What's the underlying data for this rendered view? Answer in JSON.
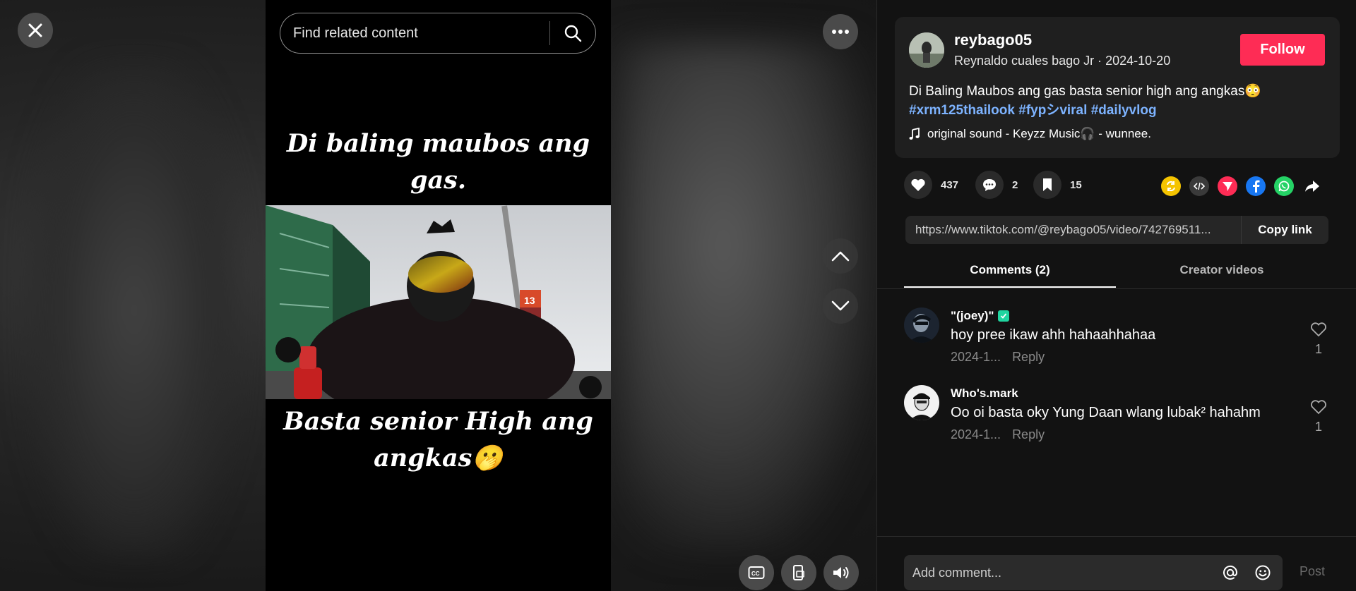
{
  "search": {
    "placeholder": "Find related content"
  },
  "video": {
    "caption_top": "Di baling maubos ang gas.",
    "caption_bottom": "Basta senior High ang angkas🫢",
    "sign_number": "13"
  },
  "author": {
    "username": "reybago05",
    "display_name": "Reynaldo cuales bago Jr",
    "separator": " · ",
    "date": "2024-10-20",
    "follow_label": "Follow"
  },
  "description": {
    "text": "Di Baling Maubos ang gas basta senior high ang angkas😳",
    "hashtags": [
      "#xrm125thailook",
      "#fypシviral",
      "#dailyvlog"
    ],
    "sound": "original sound - Keyzz Music🎧 - wunnee."
  },
  "actions": {
    "likes": "437",
    "comments": "2",
    "saves": "15"
  },
  "share": {
    "link": "https://www.tiktok.com/@reybago05/video/742769511...",
    "copy_label": "Copy link",
    "colors": {
      "repost": "#f5c400",
      "embed": "#3a3a3a",
      "send": "#fe2c55",
      "facebook": "#1877f2",
      "whatsapp": "#25d366"
    }
  },
  "tabs": [
    {
      "label": "Comments (2)",
      "active": true
    },
    {
      "label": "Creator videos",
      "active": false
    }
  ],
  "comments": [
    {
      "user": "\"(joey)\"",
      "verified": true,
      "text": "hoy pree ikaw ahh hahaahhahaa",
      "date": "2024-1...",
      "reply": "Reply",
      "likes": "1"
    },
    {
      "user": "Who's.mark",
      "verified": false,
      "text": "Oo oi basta oky Yung Daan wlang lubak² hahahm",
      "date": "2024-1...",
      "reply": "Reply",
      "likes": "1"
    }
  ],
  "composer": {
    "placeholder": "Add comment...",
    "post_label": "Post"
  },
  "accent": "#fe2c55"
}
